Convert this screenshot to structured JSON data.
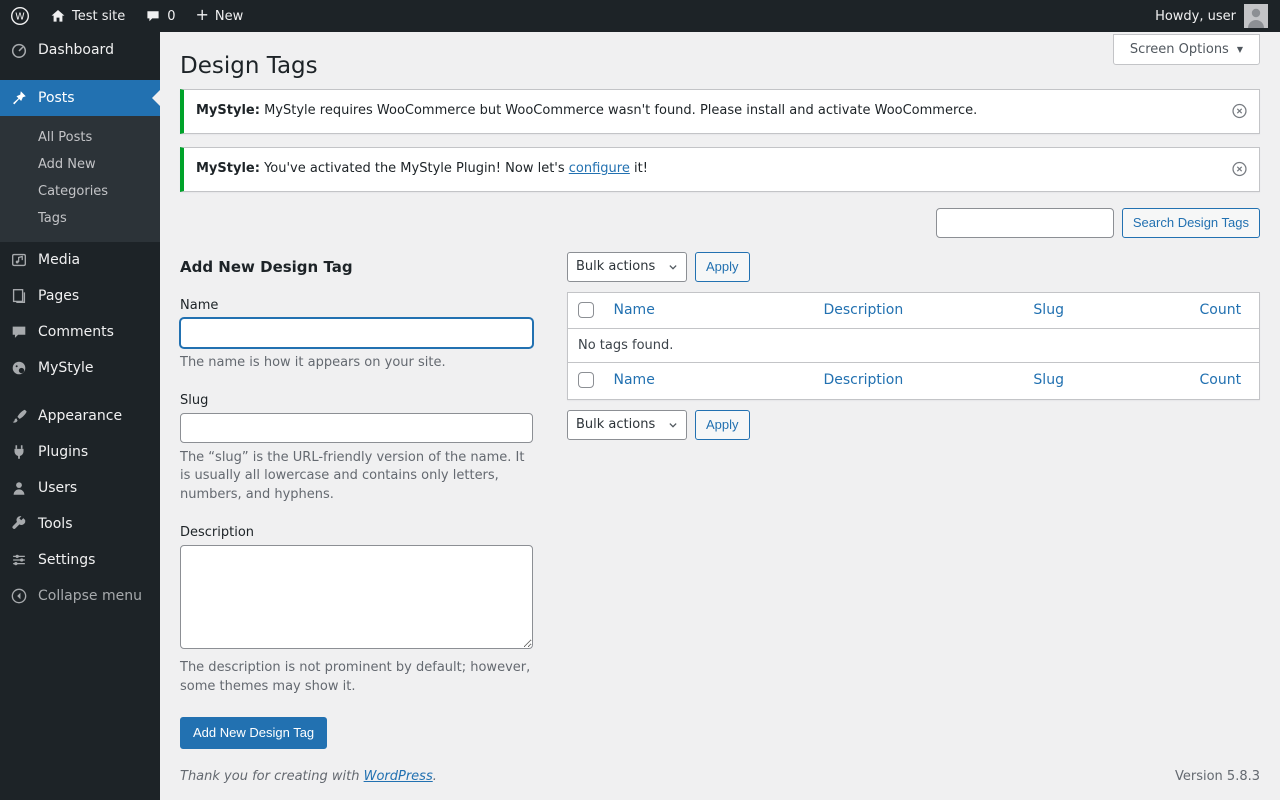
{
  "colors": {
    "accent": "#2271b1",
    "menu_bg": "#1d2327",
    "submenu_bg": "#2c3338",
    "content_bg": "#f0f0f1",
    "notice_green": "#00a32a"
  },
  "icons": {
    "plus": "+",
    "chevron_down": "▼"
  },
  "admin_bar": {
    "site_name": "Test site",
    "comments_count": "0",
    "new_label": "New",
    "howdy": "Howdy, user"
  },
  "sidebar": {
    "items": [
      {
        "label": "Dashboard"
      },
      {
        "label": "Posts"
      },
      {
        "label": "Media"
      },
      {
        "label": "Pages"
      },
      {
        "label": "Comments"
      },
      {
        "label": "MyStyle"
      },
      {
        "label": "Appearance"
      },
      {
        "label": "Plugins"
      },
      {
        "label": "Users"
      },
      {
        "label": "Tools"
      },
      {
        "label": "Settings"
      }
    ],
    "posts_submenu": [
      {
        "label": "All Posts"
      },
      {
        "label": "Add New"
      },
      {
        "label": "Categories"
      },
      {
        "label": "Tags"
      }
    ],
    "collapse_label": "Collapse menu"
  },
  "page": {
    "title": "Design Tags",
    "screen_options_label": "Screen Options",
    "notices": [
      {
        "prefix": "MyStyle:",
        "message": "MyStyle requires WooCommerce but WooCommerce wasn't found. Please install and activate WooCommerce."
      },
      {
        "prefix": "MyStyle:",
        "message_before": "You've activated the MyStyle Plugin! Now let's",
        "link_text": "configure",
        "message_after": "it!"
      }
    ],
    "search": {
      "input_value": "",
      "button_label": "Search Design Tags"
    },
    "form": {
      "heading": "Add New Design Tag",
      "name_label": "Name",
      "name_value": "",
      "name_help": "The name is how it appears on your site.",
      "slug_label": "Slug",
      "slug_value": "",
      "slug_help": "The “slug” is the URL-friendly version of the name. It is usually all lowercase and contains only letters, numbers, and hyphens.",
      "description_label": "Description",
      "description_value": "",
      "description_help": "The description is not prominent by default; however, some themes may show it.",
      "submit_label": "Add New Design Tag"
    },
    "list": {
      "bulk_actions_label": "Bulk actions",
      "apply_label": "Apply",
      "columns": {
        "name": "Name",
        "description": "Description",
        "slug": "Slug",
        "count": "Count"
      },
      "empty_message": "No tags found."
    },
    "footer": {
      "thanks_text": "Thank you for creating with",
      "thanks_link": "WordPress",
      "thanks_period": ".",
      "version": "Version 5.8.3"
    }
  }
}
